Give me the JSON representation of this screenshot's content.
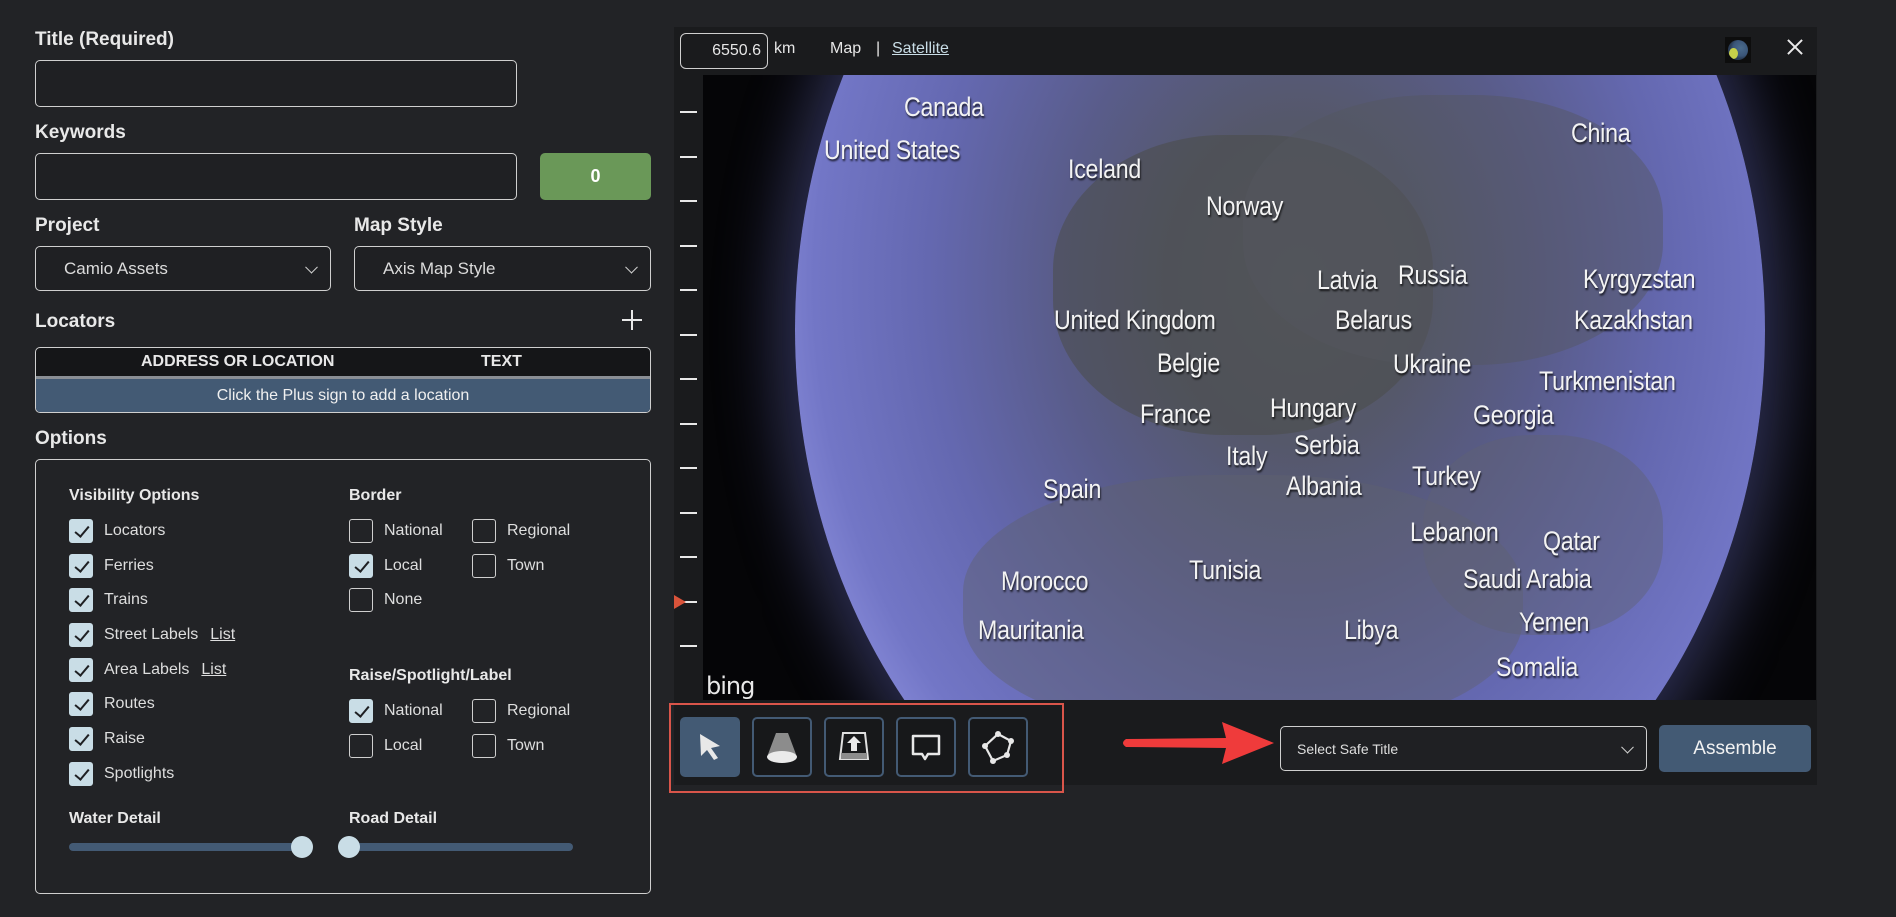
{
  "form": {
    "title_label": "Title (Required)",
    "title_value": "",
    "keywords_label": "Keywords",
    "keywords_value": "",
    "keyword_count": "0",
    "project_label": "Project",
    "project_value": "Camio Assets",
    "map_style_label": "Map Style",
    "map_style_value": "Axis Map Style"
  },
  "locators": {
    "heading": "Locators",
    "add_icon": "plus-icon",
    "columns": [
      "ADDRESS OR LOCATION",
      "TEXT"
    ],
    "empty_message": "Click the Plus sign to add a location"
  },
  "options": {
    "heading": "Options",
    "visibility": {
      "heading": "Visibility Options",
      "items": [
        {
          "label": "Locators",
          "checked": true
        },
        {
          "label": "Ferries",
          "checked": true
        },
        {
          "label": "Trains",
          "checked": true
        },
        {
          "label": "Street Labels",
          "checked": true,
          "link": "List"
        },
        {
          "label": "Area Labels",
          "checked": true,
          "link": "List"
        },
        {
          "label": "Routes",
          "checked": true
        },
        {
          "label": "Raise",
          "checked": true
        },
        {
          "label": "Spotlights",
          "checked": true
        }
      ]
    },
    "border": {
      "heading": "Border",
      "items": [
        {
          "label": "National",
          "checked": false
        },
        {
          "label": "Regional",
          "checked": false
        },
        {
          "label": "Local",
          "checked": true
        },
        {
          "label": "Town",
          "checked": false
        },
        {
          "label": "None",
          "checked": false
        }
      ]
    },
    "raise_spotlight_label": {
      "heading": "Raise/Spotlight/Label",
      "items": [
        {
          "label": "National",
          "checked": true
        },
        {
          "label": "Regional",
          "checked": false
        },
        {
          "label": "Local",
          "checked": false
        },
        {
          "label": "Town",
          "checked": false
        }
      ]
    },
    "water_detail": {
      "label": "Water Detail",
      "value_percent": 100
    },
    "road_detail": {
      "label": "Road Detail",
      "value_percent": 0
    }
  },
  "map": {
    "distance_value": "6550.6",
    "distance_unit": "km",
    "mode_map": "Map",
    "mode_separator": "|",
    "mode_satellite": "Satellite",
    "globe_icon": "globe-icon",
    "close_icon": "close-icon",
    "zoom_scale": {
      "ticks": 13,
      "current_tick": 12
    },
    "provider": "bing",
    "country_labels": [
      "Canada",
      "United States",
      "Iceland",
      "Norway",
      "China",
      "Latvia",
      "Russia",
      "Kyrgyzstan",
      "Kazakhstan",
      "United Kingdom",
      "Belarus",
      "Belgie",
      "Ukraine",
      "Turkmenistan",
      "France",
      "Hungary",
      "Georgia",
      "Italy",
      "Serbia",
      "Spain",
      "Albania",
      "Turkey",
      "Lebanon",
      "Qatar",
      "Tunisia",
      "Morocco",
      "Saudi Arabia",
      "Yemen",
      "Mauritania",
      "Libya",
      "Somalia"
    ]
  },
  "tools": [
    {
      "name": "select-tool",
      "icon": "cursor-arrow-icon",
      "active": true
    },
    {
      "name": "spotlight-tool",
      "icon": "spotlight-cone-icon",
      "active": false
    },
    {
      "name": "raise-tool",
      "icon": "raise-upload-icon",
      "active": false
    },
    {
      "name": "label-tool",
      "icon": "speech-bubble-icon",
      "active": false
    },
    {
      "name": "polygon-tool",
      "icon": "polygon-icon",
      "active": false
    }
  ],
  "bottom": {
    "safe_title_placeholder": "Select Safe Title",
    "assemble_label": "Assemble"
  },
  "colors": {
    "background": "#222326",
    "accent_blue": "#435a74",
    "checkbox_fill": "#c9dde6",
    "count_green": "#6a9858",
    "highlight_red": "#d9554a"
  }
}
